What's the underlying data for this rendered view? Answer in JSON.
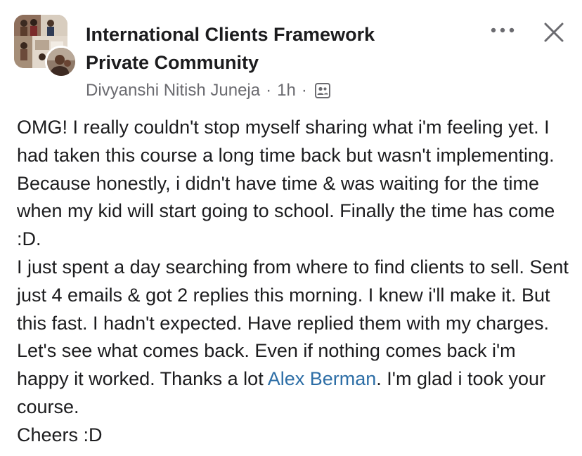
{
  "header": {
    "group_name_line1": "International Clients Framework",
    "group_name_line2": "Private Community",
    "author": "Divyanshi Nitish Juneja",
    "separator": "·",
    "time": "1h",
    "audience_icon": "members-only-group-icon",
    "more_icon": "more-dots-icon",
    "close_icon": "close-icon"
  },
  "post": {
    "paragraph1": "OMG! I really couldn't stop myself sharing what i'm feeling yet. I had taken this course a long time back but wasn't implementing. Because honestly, i didn't have time & was waiting for the time when my kid will start going to school. Finally the time has come :D.",
    "paragraph2_before_mention": "I just spent a day searching from where to find clients to sell. Sent just 4 emails & got 2 replies this morning. I knew i'll make it. But this fast. I hadn't expected. Have replied them with my charges. Let's see what comes back. Even if nothing comes back i'm happy it worked. Thanks a lot ",
    "mention": "Alex Berman",
    "paragraph2_after_mention": ". I'm glad i took your course.",
    "closing": "Cheers :D"
  },
  "colors": {
    "text": "#1c1c1e",
    "meta_text": "#6b6b70",
    "mention": "#2d6ea6",
    "icon": "#6b6b70"
  }
}
